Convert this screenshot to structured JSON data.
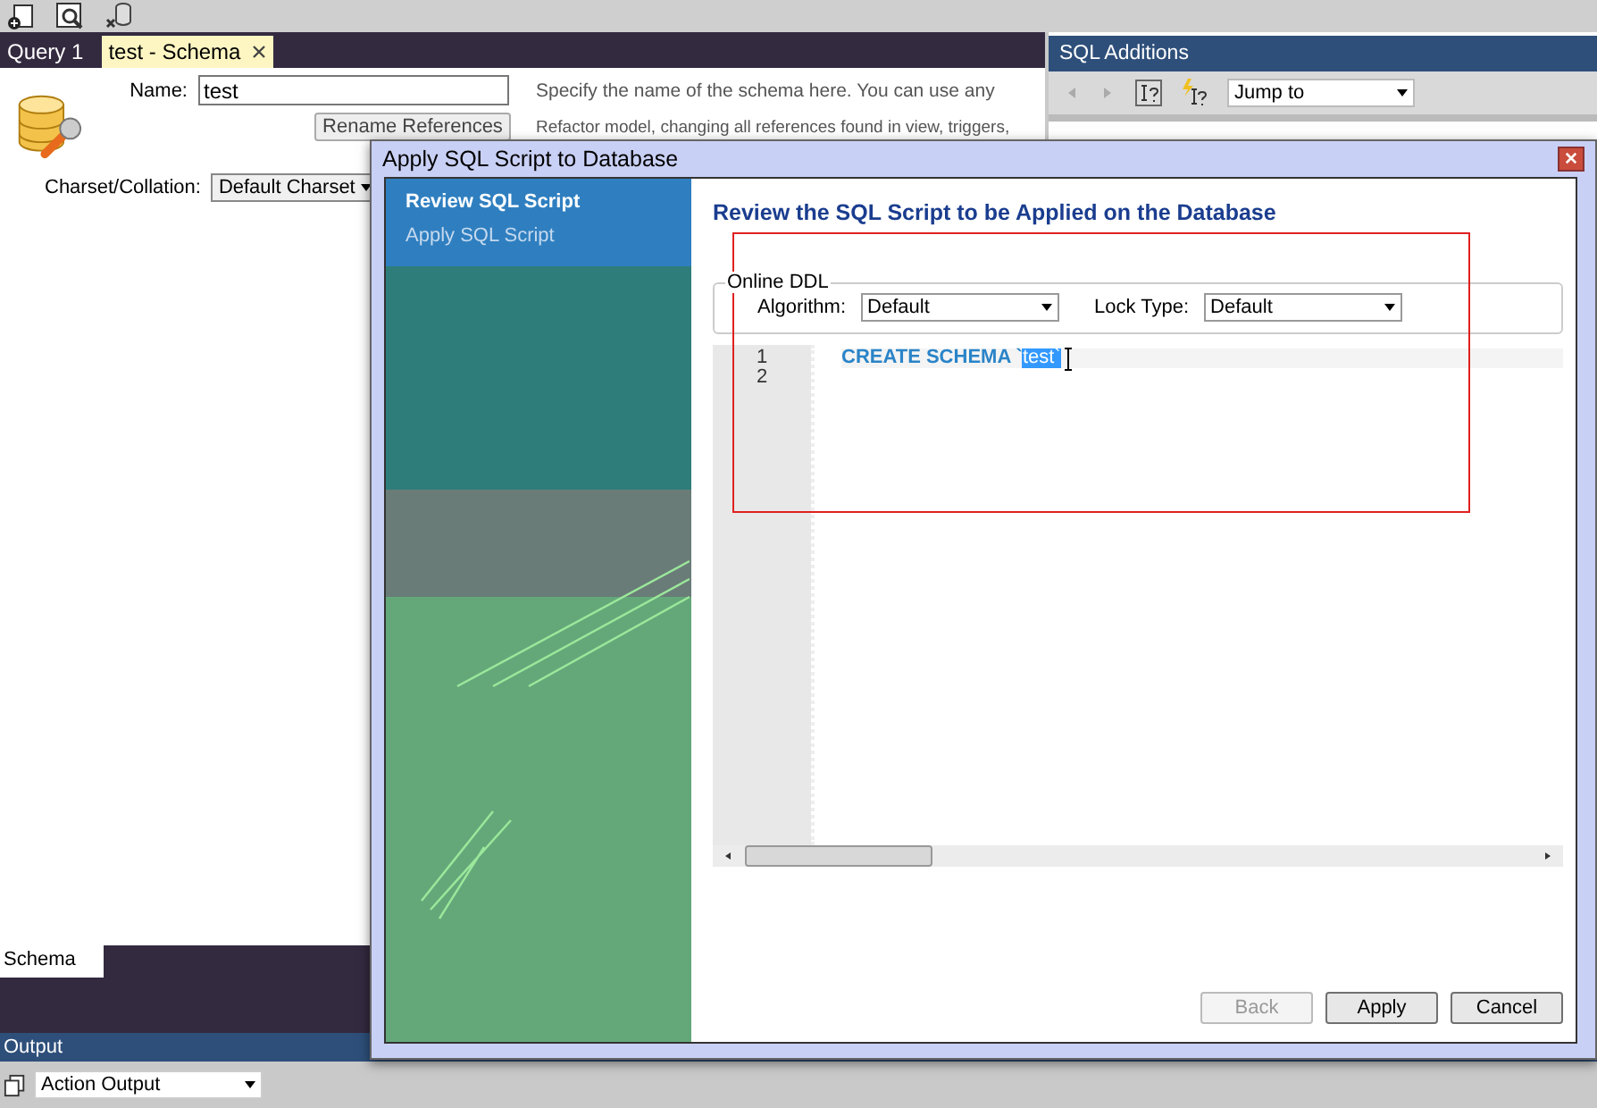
{
  "tabs": [
    {
      "label": "Query 1",
      "selected": false,
      "closable": false
    },
    {
      "label": "test - Schema",
      "selected": true,
      "closable": true
    }
  ],
  "schema_editor": {
    "name_label": "Name:",
    "name_value": "test",
    "name_hint": "Specify the name of the schema here. You can use any",
    "rename_button": "Rename References",
    "rename_hint": "Refactor model, changing all references found in view, triggers,",
    "charset_label": "Charset/Collation:",
    "charset_value": "Default Charset"
  },
  "bottom_tabs": [
    {
      "label": "Schema",
      "selected": true
    }
  ],
  "output_panel": {
    "title": "Output",
    "view": "Action Output"
  },
  "sql_additions": {
    "title": "SQL Additions",
    "jump_to": "Jump to"
  },
  "dialog": {
    "title": "Apply SQL Script to Database",
    "steps": [
      {
        "label": "Review SQL Script",
        "selected": true
      },
      {
        "label": "Apply SQL Script",
        "selected": false
      }
    ],
    "heading": "Review the SQL Script to be Applied on the Database",
    "online_ddl": {
      "title": "Online DDL",
      "algorithm_label": "Algorithm:",
      "algorithm": "Default",
      "lock_type_label": "Lock Type:",
      "lock_type": "Default"
    },
    "script_lines": [
      {
        "number": "1",
        "parts": [
          {
            "text": "CREATE SCHEMA `",
            "kind": "keyword",
            "selected": false
          },
          {
            "text": "test`",
            "kind": "identifier",
            "selected": true
          }
        ]
      },
      {
        "number": "2"
      }
    ],
    "buttons": [
      {
        "label": "Back",
        "disabled": true
      },
      {
        "label": "Apply",
        "disabled": false
      },
      {
        "label": "Cancel",
        "disabled": false
      }
    ]
  }
}
